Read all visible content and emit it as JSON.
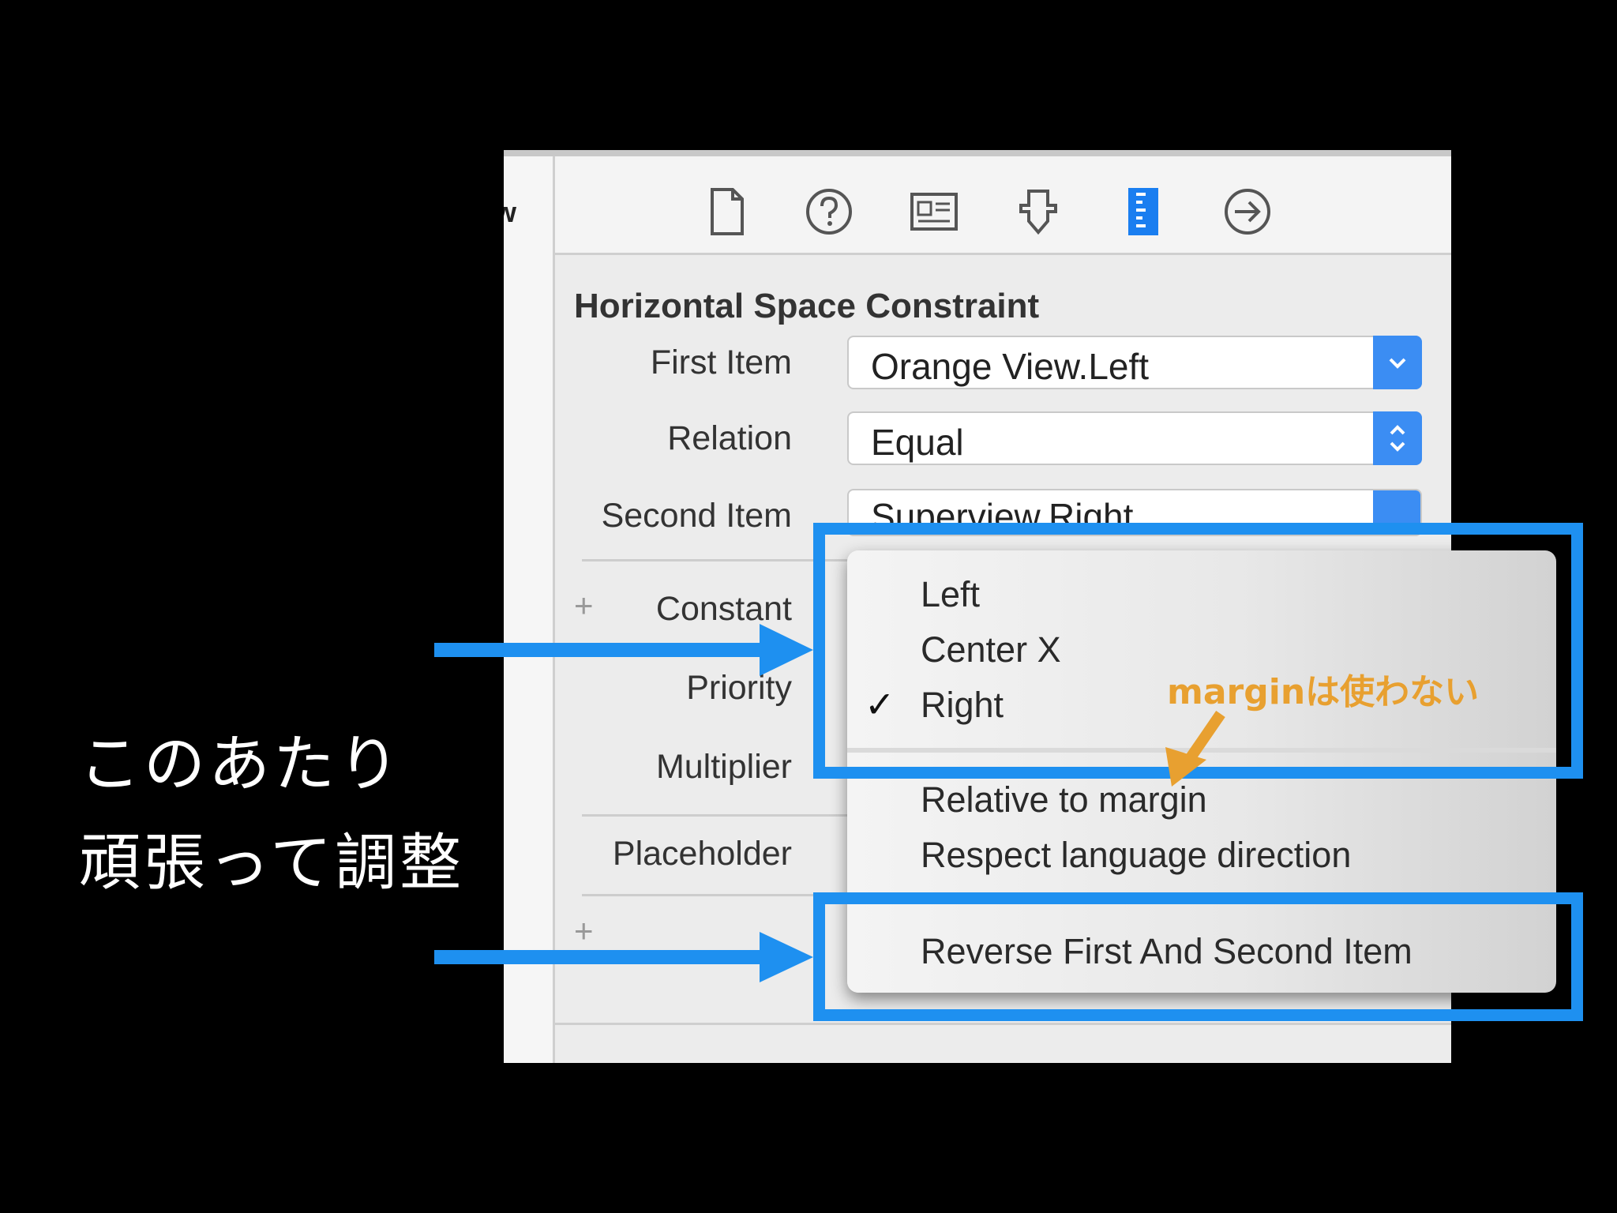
{
  "slide": {
    "line1": "このあたり",
    "line2": "頑張って調整"
  },
  "left_strip": {
    "label": "w"
  },
  "toolbar": {
    "icons": [
      "file-icon",
      "help-icon",
      "identity-icon",
      "attributes-icon",
      "size-icon",
      "connections-icon"
    ],
    "selected": "size-icon"
  },
  "inspector": {
    "title": "Horizontal Space Constraint",
    "first_item": {
      "label": "First Item",
      "value": "Orange View.Left"
    },
    "relation": {
      "label": "Relation",
      "value": "Equal"
    },
    "second_item": {
      "label": "Second Item",
      "value": "Superview.Right"
    },
    "constant": {
      "label": "Constant"
    },
    "priority": {
      "label": "Priority"
    },
    "multiplier": {
      "label": "Multiplier"
    },
    "placeholder": {
      "label": "Placeholder"
    }
  },
  "menu": {
    "items": [
      "Left",
      "Center X",
      "Right"
    ],
    "checked": "Right",
    "options": [
      "Relative to margin",
      "Respect language direction"
    ],
    "action": "Reverse First And Second Item"
  },
  "annotation": {
    "text": "marginは使わない"
  },
  "colors": {
    "highlight": "#1e90f0",
    "annotation": "#e8a030",
    "popup_button": "#3b8df3",
    "selected_icon": "#1a7ef0"
  }
}
